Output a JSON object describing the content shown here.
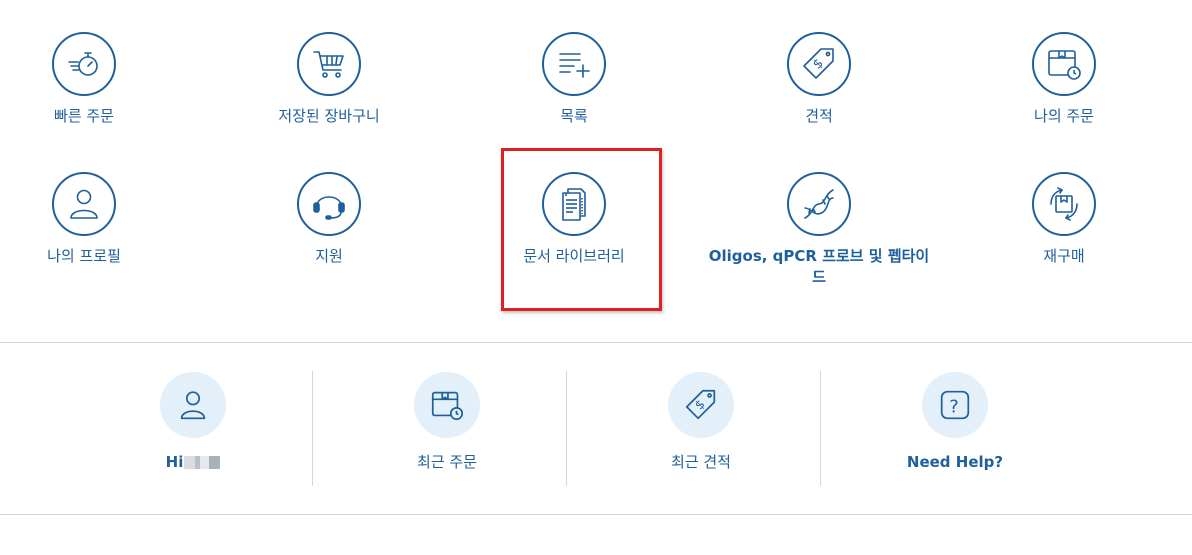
{
  "tiles": [
    {
      "label": "빠른 주문",
      "icon": "quick-order-stopwatch-icon"
    },
    {
      "label": "저장된 장바구니",
      "icon": "shopping-cart-icon"
    },
    {
      "label": "목록",
      "icon": "list-add-icon"
    },
    {
      "label": "견적",
      "icon": "price-tag-dollar-icon"
    },
    {
      "label": "나의 주문",
      "icon": "order-box-clock-icon"
    },
    {
      "label": "나의 프로필",
      "icon": "user-profile-icon"
    },
    {
      "label": "지원",
      "icon": "headset-support-icon"
    },
    {
      "label": "문서 라이브러리",
      "icon": "document-library-icon"
    },
    {
      "label": "Oligos, qPCR 프로브 및 펩타이드",
      "icon": "dna-helix-icon"
    },
    {
      "label": "재구매",
      "icon": "reorder-box-icon"
    }
  ],
  "bottom": [
    {
      "label": "Hi",
      "icon": "user-icon"
    },
    {
      "label": "최근 주문",
      "icon": "recent-order-box-icon"
    },
    {
      "label": "최근 견적",
      "icon": "recent-quote-tag-icon"
    },
    {
      "label": "Need Help?",
      "icon": "help-question-icon"
    }
  ],
  "colors": {
    "accent": "#1f5f9c",
    "highlight": "#e02020",
    "light": "#e3f0f9"
  }
}
